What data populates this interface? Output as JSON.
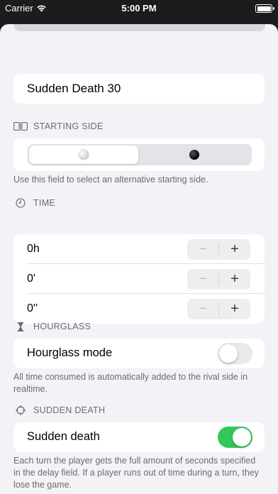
{
  "statusbar": {
    "carrier": "Carrier",
    "time": "5:00 PM"
  },
  "form": {
    "name": "Sudden Death 30",
    "starting_side": {
      "header": "STARTING SIDE",
      "options": [
        "white-stone",
        "black-stone"
      ],
      "selected": "white-stone",
      "footer": "Use this field to select an alternative starting side."
    },
    "time": {
      "header": "TIME",
      "rows": [
        {
          "value": "0h"
        },
        {
          "value": "0'"
        },
        {
          "value": "0''"
        }
      ]
    },
    "hourglass": {
      "header": "HOURGLASS",
      "label": "Hourglass mode",
      "enabled": false,
      "footer": "All time consumed is automatically added to the rival side in realtime."
    },
    "sudden_death": {
      "header": "SUDDEN DEATH",
      "label": "Sudden death",
      "enabled": true,
      "footer": "Each turn the player gets the full amount of seconds specified in the delay field. If a player runs out of time during a turn, they lose the game."
    }
  },
  "colors": {
    "accent_on": "#34c759",
    "background": "#f2f2f7"
  },
  "icons": {
    "starting_side": "side-toggle-icon",
    "time": "clock-icon",
    "hourglass": "hourglass-icon",
    "sudden_death": "crosshair-icon"
  }
}
